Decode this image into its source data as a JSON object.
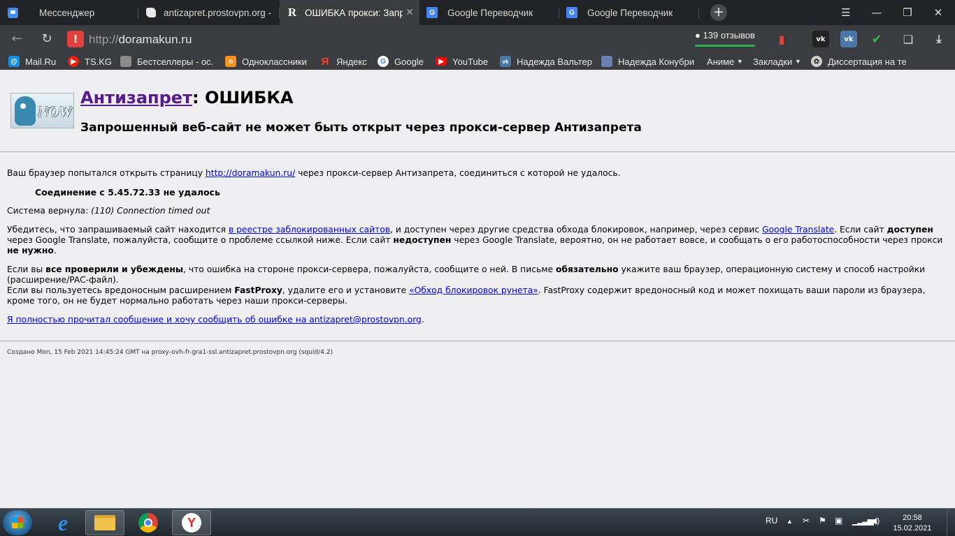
{
  "tabs": [
    {
      "title": "Мессенджер",
      "icon": "messenger-icon"
    },
    {
      "title": "antizapret.prostovpn.org -",
      "icon": "hand-icon"
    },
    {
      "title": "ОШИБКА прокси: Запро",
      "icon": "r-icon",
      "active": true
    },
    {
      "title": "Google Переводчик",
      "icon": "google-translate-icon"
    },
    {
      "title": "Google Переводчик",
      "icon": "google-translate-icon"
    }
  ],
  "address": {
    "protocol": "http://",
    "host": "doramakun.ru"
  },
  "reviews_label": "139 отзывов",
  "bookmarks": [
    {
      "label": "Mail.Ru",
      "icon": "mailru-icon",
      "color": "#168de2"
    },
    {
      "label": "TS.KG",
      "icon": "play-icon",
      "color": "#e62117"
    },
    {
      "label": "Бестселлеры - ос.l",
      "icon": "book-icon",
      "color": "#8a8a8a"
    },
    {
      "label": "Одноклассники",
      "icon": "ok-icon",
      "color": "#f7931e"
    },
    {
      "label": "Яндекс",
      "icon": "yandex-icon",
      "color": "#fc3f1d"
    },
    {
      "label": "Google",
      "icon": "google-icon",
      "color": "#ffffff"
    },
    {
      "label": "YouTube",
      "icon": "youtube-icon",
      "color": "#ff0000"
    },
    {
      "label": "Надежда Вальтер",
      "icon": "vk-icon",
      "color": "#4a76a8"
    },
    {
      "label": "Надежда Конубри",
      "icon": "shield-icon",
      "color": "#6a7fb0"
    },
    {
      "label": "Аниме",
      "icon": "folder-dropdown"
    },
    {
      "label": "Закладки",
      "icon": "folder-dropdown"
    },
    {
      "label": "Диссертация на те",
      "icon": "paw-icon",
      "color": "#cfcfcf"
    }
  ],
  "page": {
    "heading_link": "Антизапрет",
    "heading_rest": ": ОШИБКА",
    "subheading": "Запрошенный веб-сайт не может быть открыт через прокси-сервер Антизапрета",
    "p1_before": "Ваш браузер попытался открыть страницу ",
    "p1_link": "http://doramakun.ru/",
    "p1_after": " через прокси-сервер Антизапрета, соединиться с которой не удалось.",
    "connection_failed": "Соединение с 5.45.72.33 не удалось",
    "system_label": "Система вернула: ",
    "system_error": "(110) Connection timed out",
    "p3_a": "Убедитесь, что запрашиваемый сайт находится ",
    "p3_link1": "в реестре заблокированных сайтов",
    "p3_b": ", и доступен через другие средства обхода блокировок, например, через сервис ",
    "p3_link2": "Google Translate",
    "p3_c": ". Если сайт ",
    "p3_bold1": "доступен",
    "p3_d": " через Google Translate, пожалуйста, сообщите о проблеме ссылкой ниже. Если сайт ",
    "p3_bold2": "недоступен",
    "p3_e": " через Google Translate, вероятно, он не работает вовсе, и сообщать о его работоспособности через прокси ",
    "p3_bold3": "не нужно",
    "p3_f": ".",
    "p4_a": "Если вы ",
    "p4_bold1": "все проверили и убеждены",
    "p4_b": ", что ошибка на стороне прокси-сервера, пожалуйста, сообщите о ней. В письме ",
    "p4_bold2": "обязательно",
    "p4_c": " укажите ваш браузер, операционную систему и способ настройки (расширение/PAC-файл).",
    "p4_d": "Если вы пользуетесь вредоносным расширением ",
    "p4_bold3": "FastProxy",
    "p4_e": ", удалите его и установите ",
    "p4_link": "«Обход блокировок рунета»",
    "p4_f": ". FastProxy содержит вредоносный код и может похищать ваши пароли из браузера, кроме того, он не будет нормально работать через наши прокси-серверы.",
    "report_link": "Я полностью прочитал сообщение и хочу сообщить об ошибке на antizapret@prostovpn.org",
    "report_after": ".",
    "footer": "Создано Mon, 15 Feb 2021 14:45:24 GMT на proxy-ovh-fr-gra1-ssl.antizapret.prostovpn.org (squid/4.2)"
  },
  "logo": {
    "text": "NOW"
  },
  "taskbar": {
    "language": "RU",
    "time": "20:58",
    "date": "15.02.2021"
  }
}
